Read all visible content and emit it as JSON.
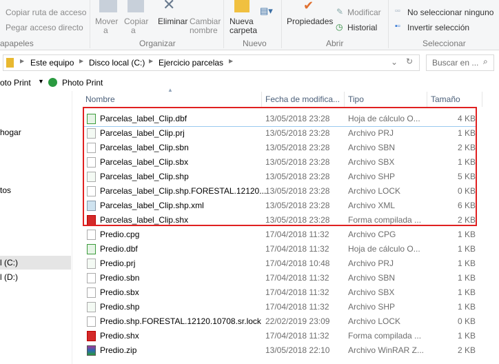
{
  "ribbon": {
    "clipboard": {
      "copy_path": "Copiar ruta de acceso",
      "paste_shortcut": "Pegar acceso directo",
      "group": "apapeles"
    },
    "organize": {
      "move": "Mover",
      "move2": "a",
      "copy": "Copiar",
      "copy2": "a",
      "delete": "Eliminar",
      "rename": "Cambiar",
      "rename2": "nombre",
      "group": "Organizar"
    },
    "new": {
      "new_folder": "Nueva",
      "new_folder2": "carpeta",
      "group": "Nuevo"
    },
    "open": {
      "properties": "Propiedades",
      "edit": "Modificar",
      "history": "Historial",
      "group": "Abrir"
    },
    "select": {
      "select_none": "No seleccionar ninguno",
      "invert": "Invertir selección",
      "group": "Seleccionar"
    }
  },
  "address": {
    "crumbs": [
      "Este equipo",
      "Disco local (C:)",
      "Ejercicio parcelas"
    ],
    "search_placeholder": "Buscar en ..."
  },
  "toolbar": {
    "left": "oto Print",
    "photo_print": "Photo Print"
  },
  "sidebar": {
    "items": [
      "hogar",
      "tos",
      "l (C:)",
      "l (D:)"
    ]
  },
  "columns": {
    "name": "Nombre",
    "date": "Fecha de modifica...",
    "type": "Tipo",
    "size": "Tamaño"
  },
  "files": [
    {
      "name": "Parcelas_label_Clip.dbf",
      "date": "13/05/2018 23:28",
      "type": "Hoja de cálculo O...",
      "size": "4 KB",
      "icon": "spreadsheet"
    },
    {
      "name": "Parcelas_label_Clip.prj",
      "date": "13/05/2018 23:28",
      "type": "Archivo PRJ",
      "size": "1 KB",
      "icon": "prj"
    },
    {
      "name": "Parcelas_label_Clip.sbn",
      "date": "13/05/2018 23:28",
      "type": "Archivo SBN",
      "size": "2 KB",
      "icon": "blank"
    },
    {
      "name": "Parcelas_label_Clip.sbx",
      "date": "13/05/2018 23:28",
      "type": "Archivo SBX",
      "size": "1 KB",
      "icon": "blank"
    },
    {
      "name": "Parcelas_label_Clip.shp",
      "date": "13/05/2018 23:28",
      "type": "Archivo SHP",
      "size": "5 KB",
      "icon": "prj"
    },
    {
      "name": "Parcelas_label_Clip.shp.FORESTAL.12120....",
      "date": "13/05/2018 23:28",
      "type": "Archivo LOCK",
      "size": "0 KB",
      "icon": "blank"
    },
    {
      "name": "Parcelas_label_Clip.shp.xml",
      "date": "13/05/2018 23:28",
      "type": "Archivo XML",
      "size": "6 KB",
      "icon": "xml"
    },
    {
      "name": "Parcelas_label_Clip.shx",
      "date": "13/05/2018 23:28",
      "type": "Forma compilada ...",
      "size": "2 KB",
      "icon": "shx"
    },
    {
      "name": "Predio.cpg",
      "date": "17/04/2018 11:32",
      "type": "Archivo CPG",
      "size": "1 KB",
      "icon": "blank"
    },
    {
      "name": "Predio.dbf",
      "date": "17/04/2018 11:32",
      "type": "Hoja de cálculo O...",
      "size": "1 KB",
      "icon": "spreadsheet"
    },
    {
      "name": "Predio.prj",
      "date": "17/04/2018 10:48",
      "type": "Archivo PRJ",
      "size": "1 KB",
      "icon": "prj"
    },
    {
      "name": "Predio.sbn",
      "date": "17/04/2018 11:32",
      "type": "Archivo SBN",
      "size": "1 KB",
      "icon": "blank"
    },
    {
      "name": "Predio.sbx",
      "date": "17/04/2018 11:32",
      "type": "Archivo SBX",
      "size": "1 KB",
      "icon": "blank"
    },
    {
      "name": "Predio.shp",
      "date": "17/04/2018 11:32",
      "type": "Archivo SHP",
      "size": "1 KB",
      "icon": "prj"
    },
    {
      "name": "Predio.shp.FORESTAL.12120.10708.sr.lock",
      "date": "22/02/2019 23:09",
      "type": "Archivo LOCK",
      "size": "0 KB",
      "icon": "blank"
    },
    {
      "name": "Predio.shx",
      "date": "17/04/2018 11:32",
      "type": "Forma compilada ...",
      "size": "1 KB",
      "icon": "shx"
    },
    {
      "name": "Predio.zip",
      "date": "13/05/2018 22:10",
      "type": "Archivo WinRAR Z...",
      "size": "2 KB",
      "icon": "winrar"
    }
  ],
  "colors": {
    "highlight_box": "#e02020",
    "header_text": "#4c607a"
  }
}
